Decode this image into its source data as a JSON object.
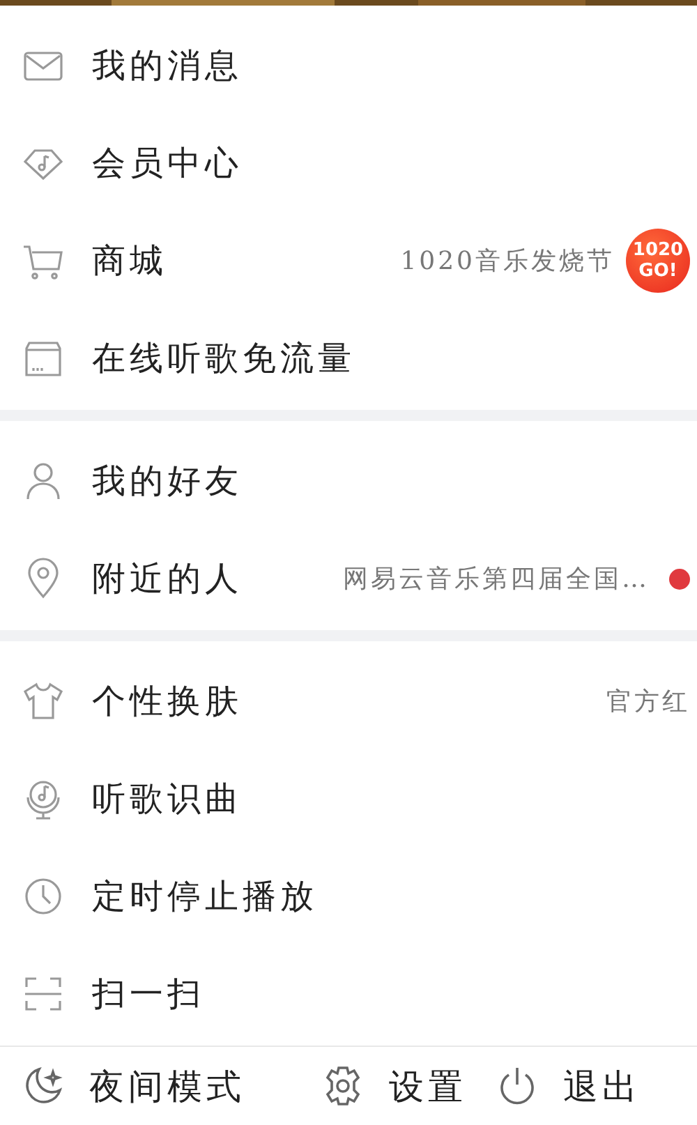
{
  "sections": [
    {
      "items": [
        {
          "label": "我的消息",
          "dot": false
        },
        {
          "label": "会员中心",
          "dot": false
        },
        {
          "label": "商城",
          "detail": "1020音乐发烧节",
          "badge": [
            "1020",
            "GO!"
          ],
          "dot": false
        },
        {
          "label": "在线听歌免流量",
          "dot": false
        }
      ]
    },
    {
      "items": [
        {
          "label": "我的好友",
          "dot": false
        },
        {
          "label": "附近的人",
          "detail": "网易云音乐第四届全国…",
          "dot": true
        }
      ]
    },
    {
      "items": [
        {
          "label": "个性换肤",
          "detail": "官方红",
          "dot": false
        },
        {
          "label": "听歌识曲",
          "dot": false
        },
        {
          "label": "定时停止播放",
          "dot": false
        },
        {
          "label": "扫一扫",
          "dot": false
        }
      ]
    }
  ],
  "bottom_bar": [
    {
      "label": "夜间模式"
    },
    {
      "label": "设置"
    },
    {
      "label": "退出"
    }
  ]
}
